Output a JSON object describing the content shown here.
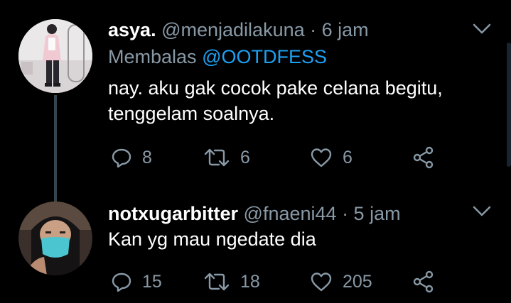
{
  "tweets": [
    {
      "display_name": "asya.",
      "handle": "@menjadilakuna",
      "time": "· 6 jam",
      "reply_prefix": "Membalas",
      "reply_mention": "@OOTDFESS",
      "text_line1": "nay. aku gak cocok pake celana begitu,",
      "text_line2": "tenggelam soalnya.",
      "replies": "8",
      "retweets": "6",
      "likes": "6"
    },
    {
      "display_name": "notxugarbitter",
      "handle": "@fnaeni44",
      "time": "· 5 jam",
      "text_line1": "Kan yg mau ngedate dia",
      "replies": "15",
      "retweets": "18",
      "likes": "205"
    }
  ],
  "colors": {
    "background": "#000000",
    "secondary_text": "#8899a6",
    "mention": "#1da1f2",
    "thread_line": "#38444d"
  },
  "icons": [
    "reply-icon",
    "retweet-icon",
    "like-icon",
    "share-icon",
    "chevron-down-icon"
  ]
}
